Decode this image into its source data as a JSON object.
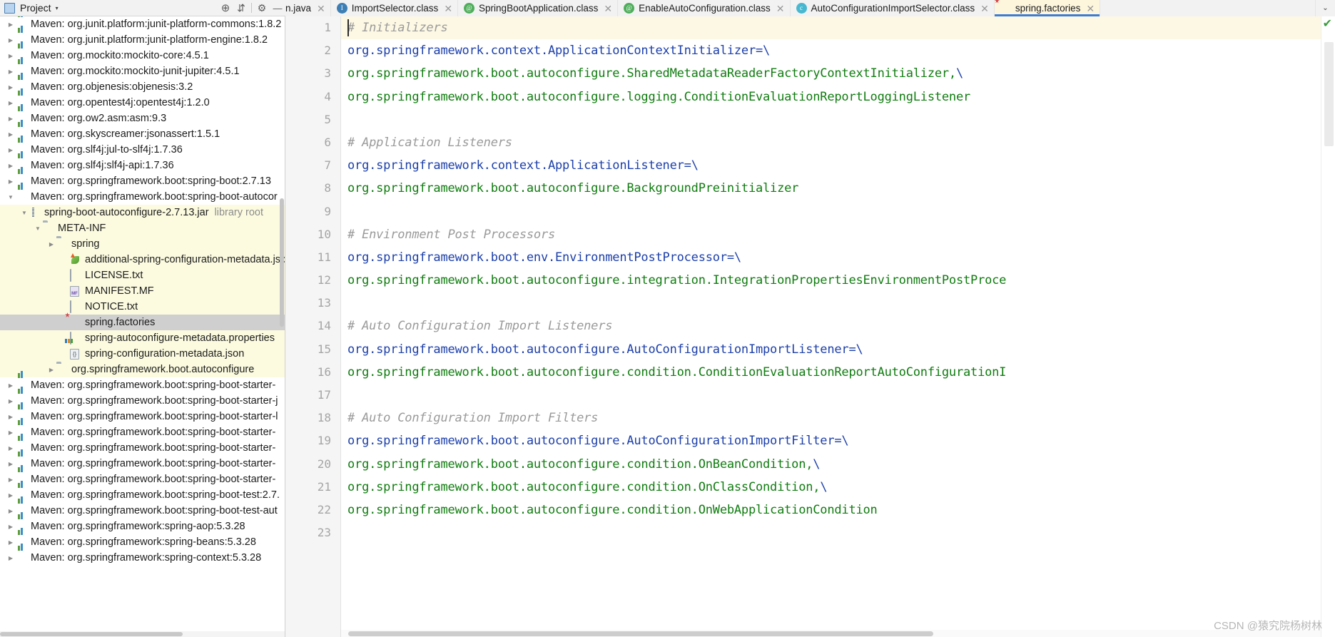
{
  "window": {
    "project_panel": {
      "title": "Project",
      "caret": "▾",
      "icon": "project-panel-icon",
      "buttons": [
        {
          "name": "locate-icon",
          "glyph": "⊕"
        },
        {
          "name": "collapse-all-icon",
          "glyph": "⇵"
        },
        {
          "name": "settings-gear-icon",
          "glyph": "⚙"
        },
        {
          "name": "hide-panel-icon",
          "glyph": "—"
        }
      ]
    }
  },
  "tabs": {
    "overflow_glyph": "⌄",
    "items": [
      {
        "label": "n.java",
        "icon": "none",
        "active": false,
        "clipped": true,
        "close": "✕"
      },
      {
        "label": "ImportSelector.class",
        "icon": "interface-icon",
        "glyph": "I",
        "active": false,
        "close": "✕"
      },
      {
        "label": "SpringBootApplication.class",
        "icon": "annotation-icon",
        "glyph": "@",
        "active": false,
        "close": "✕"
      },
      {
        "label": "EnableAutoConfiguration.class",
        "icon": "annotation-icon",
        "glyph": "@",
        "active": false,
        "close": "✕"
      },
      {
        "label": "AutoConfigurationImportSelector.class",
        "icon": "class-icon",
        "glyph": "c",
        "active": false,
        "close": "✕"
      },
      {
        "label": "spring.factories",
        "icon": "spring-leaf-icon",
        "active": true,
        "close": "✕"
      }
    ]
  },
  "sidebar": {
    "rows": [
      {
        "indent": 0,
        "arrow": "▶",
        "icon": "maven-icon",
        "label": "Maven: org.junit.platform:junit-platform-commons:1.8.2"
      },
      {
        "indent": 0,
        "arrow": "▶",
        "icon": "maven-icon",
        "label": "Maven: org.junit.platform:junit-platform-engine:1.8.2"
      },
      {
        "indent": 0,
        "arrow": "▶",
        "icon": "maven-icon",
        "label": "Maven: org.mockito:mockito-core:4.5.1"
      },
      {
        "indent": 0,
        "arrow": "▶",
        "icon": "maven-icon",
        "label": "Maven: org.mockito:mockito-junit-jupiter:4.5.1"
      },
      {
        "indent": 0,
        "arrow": "▶",
        "icon": "maven-icon",
        "label": "Maven: org.objenesis:objenesis:3.2"
      },
      {
        "indent": 0,
        "arrow": "▶",
        "icon": "maven-icon",
        "label": "Maven: org.opentest4j:opentest4j:1.2.0"
      },
      {
        "indent": 0,
        "arrow": "▶",
        "icon": "maven-icon",
        "label": "Maven: org.ow2.asm:asm:9.3"
      },
      {
        "indent": 0,
        "arrow": "▶",
        "icon": "maven-icon",
        "label": "Maven: org.skyscreamer:jsonassert:1.5.1"
      },
      {
        "indent": 0,
        "arrow": "▶",
        "icon": "maven-icon",
        "label": "Maven: org.slf4j:jul-to-slf4j:1.7.36"
      },
      {
        "indent": 0,
        "arrow": "▶",
        "icon": "maven-icon",
        "label": "Maven: org.slf4j:slf4j-api:1.7.36"
      },
      {
        "indent": 0,
        "arrow": "▶",
        "icon": "maven-icon",
        "label": "Maven: org.springframework.boot:spring-boot:2.7.13"
      },
      {
        "indent": 0,
        "arrow": "▼",
        "icon": "maven-icon",
        "label": "Maven: org.springframework.boot:spring-boot-autocor"
      },
      {
        "indent": 1,
        "arrow": "▼",
        "icon": "jar-icon",
        "label": "spring-boot-autoconfigure-2.7.13.jar",
        "sub": "library root",
        "highlight": true
      },
      {
        "indent": 2,
        "arrow": "▼",
        "icon": "folder-icon",
        "label": "META-INF",
        "highlight": true
      },
      {
        "indent": 3,
        "arrow": "▶",
        "icon": "folder-icon",
        "label": "spring",
        "highlight": true
      },
      {
        "indent": 4,
        "arrow": "",
        "icon": "additional-metadata-icon",
        "label": "additional-spring-configuration-metadata.json",
        "highlight": true
      },
      {
        "indent": 4,
        "arrow": "",
        "icon": "text-file-icon",
        "label": "LICENSE.txt",
        "highlight": true
      },
      {
        "indent": 4,
        "arrow": "",
        "icon": "manifest-icon",
        "label": "MANIFEST.MF",
        "highlight": true
      },
      {
        "indent": 4,
        "arrow": "",
        "icon": "text-file-icon",
        "label": "NOTICE.txt",
        "highlight": true
      },
      {
        "indent": 4,
        "arrow": "",
        "icon": "spring-leaf-icon",
        "label": "spring.factories",
        "selected": true
      },
      {
        "indent": 4,
        "arrow": "",
        "icon": "properties-icon",
        "label": "spring-autoconfigure-metadata.properties",
        "highlight": true
      },
      {
        "indent": 4,
        "arrow": "",
        "icon": "json-icon",
        "label": "spring-configuration-metadata.json",
        "highlight": true
      },
      {
        "indent": 3,
        "arrow": "▶",
        "icon": "folder-icon",
        "label": "org.springframework.boot.autoconfigure",
        "highlight": true
      },
      {
        "indent": 0,
        "arrow": "▶",
        "icon": "maven-icon",
        "label": "Maven: org.springframework.boot:spring-boot-starter-"
      },
      {
        "indent": 0,
        "arrow": "▶",
        "icon": "maven-icon",
        "label": "Maven: org.springframework.boot:spring-boot-starter-j"
      },
      {
        "indent": 0,
        "arrow": "▶",
        "icon": "maven-icon",
        "label": "Maven: org.springframework.boot:spring-boot-starter-l"
      },
      {
        "indent": 0,
        "arrow": "▶",
        "icon": "maven-icon",
        "label": "Maven: org.springframework.boot:spring-boot-starter-"
      },
      {
        "indent": 0,
        "arrow": "▶",
        "icon": "maven-icon",
        "label": "Maven: org.springframework.boot:spring-boot-starter-"
      },
      {
        "indent": 0,
        "arrow": "▶",
        "icon": "maven-icon",
        "label": "Maven: org.springframework.boot:spring-boot-starter-"
      },
      {
        "indent": 0,
        "arrow": "▶",
        "icon": "maven-icon",
        "label": "Maven: org.springframework.boot:spring-boot-starter-"
      },
      {
        "indent": 0,
        "arrow": "▶",
        "icon": "maven-icon",
        "label": "Maven: org.springframework.boot:spring-boot-test:2.7."
      },
      {
        "indent": 0,
        "arrow": "▶",
        "icon": "maven-icon",
        "label": "Maven: org.springframework.boot:spring-boot-test-aut"
      },
      {
        "indent": 0,
        "arrow": "▶",
        "icon": "maven-icon",
        "label": "Maven: org.springframework:spring-aop:5.3.28"
      },
      {
        "indent": 0,
        "arrow": "▶",
        "icon": "maven-icon",
        "label": "Maven: org.springframework:spring-beans:5.3.28"
      },
      {
        "indent": 0,
        "arrow": "▶",
        "icon": "maven-icon",
        "label": "Maven: org.springframework:spring-context:5.3.28"
      }
    ]
  },
  "editor": {
    "filename": "spring.factories",
    "inspection_status": "✔",
    "lines": [
      {
        "n": "1",
        "segments": [
          {
            "cls": "c-comment",
            "t": "# Initializers"
          }
        ]
      },
      {
        "n": "2",
        "segments": [
          {
            "cls": "c-key",
            "t": "org.springframework.context.ApplicationContextInitializer"
          },
          {
            "cls": "c-key",
            "t": "="
          },
          {
            "cls": "c-sep",
            "t": "\\"
          }
        ]
      },
      {
        "n": "3",
        "segments": [
          {
            "cls": "c-val",
            "t": "org.springframework.boot.autoconfigure.SharedMetadataReaderFactoryContextInitializer,"
          },
          {
            "cls": "c-sep",
            "t": "\\"
          }
        ]
      },
      {
        "n": "4",
        "segments": [
          {
            "cls": "c-val",
            "t": "org.springframework.boot.autoconfigure.logging.ConditionEvaluationReportLoggingListener"
          }
        ]
      },
      {
        "n": "5",
        "segments": []
      },
      {
        "n": "6",
        "segments": [
          {
            "cls": "c-comment",
            "t": "# Application Listeners"
          }
        ]
      },
      {
        "n": "7",
        "segments": [
          {
            "cls": "c-key",
            "t": "org.springframework.context.ApplicationListener="
          },
          {
            "cls": "c-sep",
            "t": "\\"
          }
        ]
      },
      {
        "n": "8",
        "segments": [
          {
            "cls": "c-val",
            "t": "org.springframework.boot.autoconfigure.BackgroundPreinitializer"
          }
        ]
      },
      {
        "n": "9",
        "segments": []
      },
      {
        "n": "10",
        "segments": [
          {
            "cls": "c-comment",
            "t": "# Environment Post Processors"
          }
        ]
      },
      {
        "n": "11",
        "segments": [
          {
            "cls": "c-key",
            "t": "org.springframework.boot.env.EnvironmentPostProcessor="
          },
          {
            "cls": "c-sep",
            "t": "\\"
          }
        ]
      },
      {
        "n": "12",
        "segments": [
          {
            "cls": "c-val",
            "t": "org.springframework.boot.autoconfigure.integration.IntegrationPropertiesEnvironmentPostProce"
          }
        ]
      },
      {
        "n": "13",
        "segments": []
      },
      {
        "n": "14",
        "segments": [
          {
            "cls": "c-comment",
            "t": "# Auto Configuration Import Listeners"
          }
        ]
      },
      {
        "n": "15",
        "segments": [
          {
            "cls": "c-key",
            "t": "org.springframework.boot.autoconfigure.AutoConfigurationImportListener="
          },
          {
            "cls": "c-sep",
            "t": "\\"
          }
        ]
      },
      {
        "n": "16",
        "segments": [
          {
            "cls": "c-val",
            "t": "org.springframework.boot.autoconfigure.condition.ConditionEvaluationReportAutoConfigurationI"
          }
        ]
      },
      {
        "n": "17",
        "segments": []
      },
      {
        "n": "18",
        "segments": [
          {
            "cls": "c-comment",
            "t": "# Auto Configuration Import Filters"
          }
        ]
      },
      {
        "n": "19",
        "segments": [
          {
            "cls": "c-key",
            "t": "org.springframework.boot.autoconfigure.AutoConfigurationImportFilter="
          },
          {
            "cls": "c-sep",
            "t": "\\"
          }
        ]
      },
      {
        "n": "20",
        "segments": [
          {
            "cls": "c-val",
            "t": "org.springframework.boot.autoconfigure.condition.OnBeanCondition,"
          },
          {
            "cls": "c-sep",
            "t": "\\"
          }
        ]
      },
      {
        "n": "21",
        "segments": [
          {
            "cls": "c-val",
            "t": "org.springframework.boot.autoconfigure.condition.OnClassCondition,"
          },
          {
            "cls": "c-sep",
            "t": "\\"
          }
        ]
      },
      {
        "n": "22",
        "segments": [
          {
            "cls": "c-val",
            "t": "org.springframework.boot.autoconfigure.condition.OnWebApplicationCondition"
          }
        ]
      },
      {
        "n": "23",
        "segments": []
      }
    ]
  },
  "watermark": {
    "text": "CSDN @猿究院杨树林"
  },
  "colors": {
    "comment": "#9a9a9a",
    "key": "#1c3faa",
    "value": "#107c10",
    "tab_active_bg": "#fdf6dd",
    "tab_active_underline": "#3c7cd5",
    "tree_highlight_bg": "#fcfbe0",
    "tree_selected_bg": "#cfcfcf",
    "inspection_ok": "#3c9c3c"
  }
}
